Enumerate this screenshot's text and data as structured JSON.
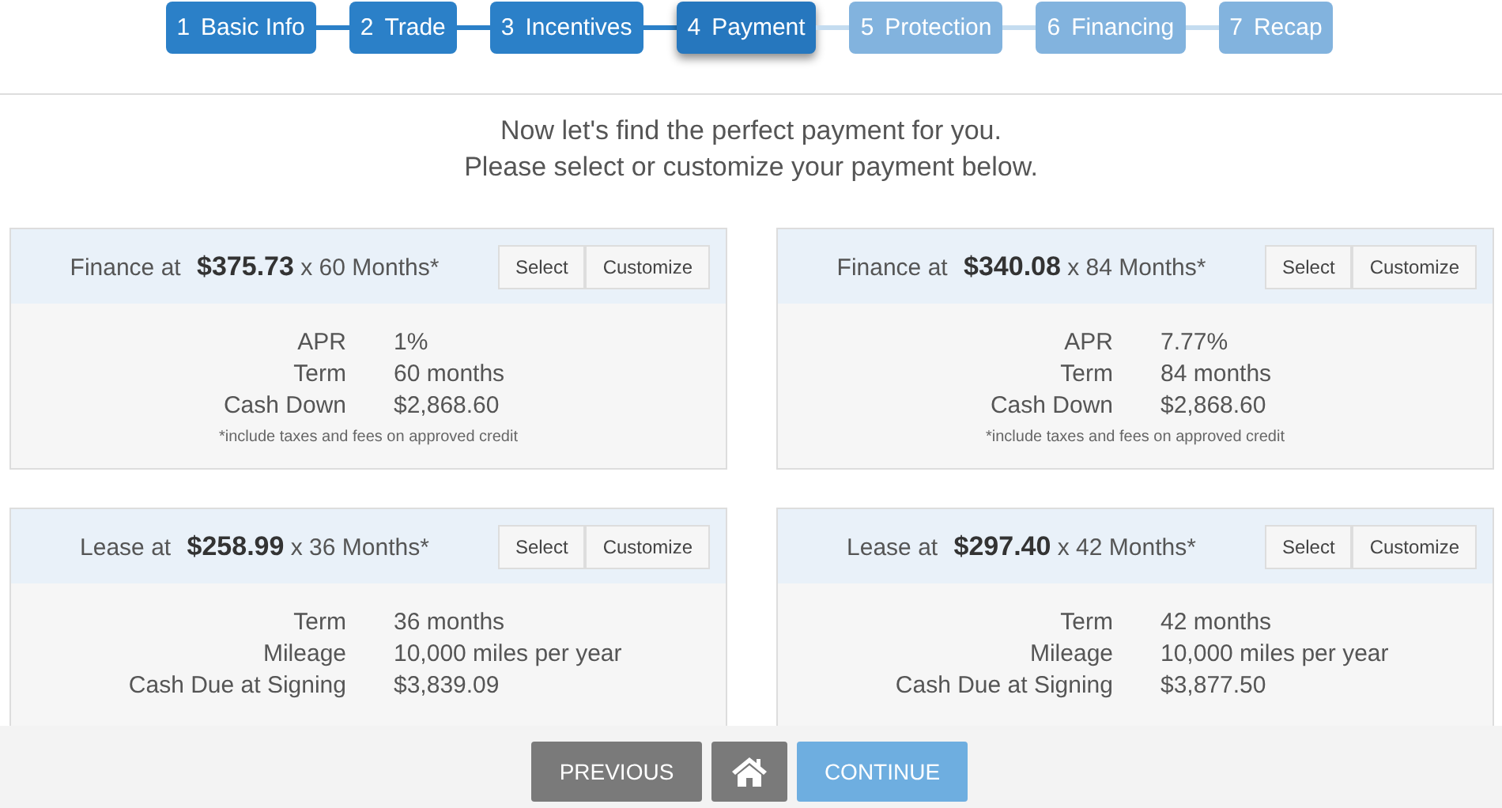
{
  "steps": [
    {
      "number": "1",
      "label": "Basic Info",
      "selected": false,
      "disabled": false
    },
    {
      "number": "2",
      "label": "Trade",
      "selected": false,
      "disabled": false
    },
    {
      "number": "3",
      "label": "Incentives",
      "selected": false,
      "disabled": false
    },
    {
      "number": "4",
      "label": "Payment",
      "selected": true,
      "disabled": false
    },
    {
      "number": "5",
      "label": "Protection",
      "selected": false,
      "disabled": true
    },
    {
      "number": "6",
      "label": "Financing",
      "selected": false,
      "disabled": true
    },
    {
      "number": "7",
      "label": "Recap",
      "selected": false,
      "disabled": true
    }
  ],
  "intro": [
    "Now let's find the perfect payment for you.",
    "Please select or customize your payment below."
  ],
  "offers": [
    {
      "title": "Finance at **$375.73** x 60 Months*",
      "buttons": [
        "Select",
        "Customize"
      ],
      "details": [
        {
          "label": "APR",
          "value": "1%"
        },
        {
          "label": "Term",
          "value": "60 months"
        },
        {
          "label": "Cash Down",
          "value": "$2,868.60"
        }
      ],
      "footnote": "*include taxes and fees on approved credit"
    },
    {
      "title": "Finance at **$340.08** x 84 Months*",
      "buttons": [
        "Select",
        "Customize"
      ],
      "details": [
        {
          "label": "APR",
          "value": "7.77%"
        },
        {
          "label": "Term",
          "value": "84 months"
        },
        {
          "label": "Cash Down",
          "value": "$2,868.60"
        }
      ],
      "footnote": "*include taxes and fees on approved credit"
    },
    {
      "title": "Lease at **$258.99** x 36 Months*",
      "buttons": [
        "Select",
        "Customize"
      ],
      "details": [
        {
          "label": "Term",
          "value": "36 months"
        },
        {
          "label": "Mileage",
          "value": "10,000 miles per year"
        },
        {
          "label": "Cash Due at Signing",
          "value": "$3,839.09"
        }
      ]
    },
    {
      "title": "Lease at **$297.40** x 42 Months*",
      "buttons": [
        "Select",
        "Customize"
      ],
      "details": [
        {
          "label": "Term",
          "value": "42 months"
        },
        {
          "label": "Mileage",
          "value": "10,000 miles per year"
        },
        {
          "label": "Cash Due at Signing",
          "value": "$3,877.50"
        }
      ]
    }
  ],
  "footer": {
    "previous": "PREVIOUS",
    "continue": "CONTINUE"
  }
}
